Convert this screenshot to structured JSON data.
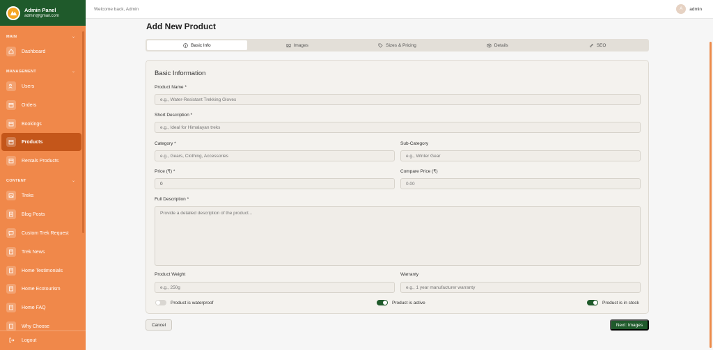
{
  "sidebar": {
    "title": "Admin Panel",
    "email": "admin@gmail.com",
    "sections": {
      "main": "MAIN",
      "management": "MANAGEMENT",
      "content": "CONTENT"
    },
    "items": [
      {
        "label": "Dashboard",
        "icon": "home-icon"
      },
      {
        "label": "Users",
        "icon": "users-icon"
      },
      {
        "label": "Orders",
        "icon": "calendar-icon"
      },
      {
        "label": "Bookings",
        "icon": "calendar-icon"
      },
      {
        "label": "Products",
        "icon": "calendar-icon",
        "active": true
      },
      {
        "label": "Rentals Products",
        "icon": "calendar-icon"
      },
      {
        "label": "Treks",
        "icon": "image-icon"
      },
      {
        "label": "Blog Posts",
        "icon": "document-icon"
      },
      {
        "label": "Custom Trek Request",
        "icon": "chat-icon"
      },
      {
        "label": "Trek News",
        "icon": "document-icon"
      },
      {
        "label": "Home Testimonials",
        "icon": "document-icon"
      },
      {
        "label": "Home Ecotourism",
        "icon": "document-icon"
      },
      {
        "label": "Home FAQ",
        "icon": "document-icon"
      },
      {
        "label": "Why Choose",
        "icon": "document-icon"
      }
    ],
    "logout": "Logout"
  },
  "topbar": {
    "welcome": "Welcome back, Admin",
    "user": "admin",
    "avatar_initial": "A"
  },
  "page": {
    "title": "Add New Product"
  },
  "tabs": [
    {
      "label": "Basic Info",
      "icon": "info-icon",
      "active": true
    },
    {
      "label": "Images",
      "icon": "image-icon"
    },
    {
      "label": "Sizes & Pricing",
      "icon": "tag-icon"
    },
    {
      "label": "Details",
      "icon": "box-icon"
    },
    {
      "label": "SEO",
      "icon": "link-icon"
    }
  ],
  "form": {
    "title": "Basic Information",
    "product_name": {
      "label": "Product Name *",
      "placeholder": "e.g., Water-Resistant Trekking Gloves"
    },
    "short_description": {
      "label": "Short Description *",
      "placeholder": "e.g., Ideal for Himalayan treks"
    },
    "category": {
      "label": "Category *",
      "placeholder": "e.g., Gears, Clothing, Accessories"
    },
    "sub_category": {
      "label": "Sub-Category",
      "placeholder": "e.g., Winter Gear"
    },
    "price": {
      "label": "Price (₹) *",
      "value": "0"
    },
    "compare_price": {
      "label": "Compare Price (₹)",
      "placeholder": "0.00"
    },
    "full_description": {
      "label": "Full Description *",
      "placeholder": "Provide a detailed description of the product..."
    },
    "weight": {
      "label": "Product Weight",
      "placeholder": "e.g., 250g"
    },
    "warranty": {
      "label": "Warranty",
      "placeholder": "e.g., 1 year manufacturer warranty"
    },
    "toggles": [
      {
        "label": "Product is waterproof",
        "on": false
      },
      {
        "label": "Product is active",
        "on": true
      },
      {
        "label": "Product is in stock",
        "on": true
      }
    ]
  },
  "actions": {
    "cancel": "Cancel",
    "next": "Next: Images"
  },
  "colors": {
    "sidebar": "#f0884a",
    "sidebar_header": "#1f5a2b",
    "active_item": "#c4561a",
    "primary": "#1f5a2b"
  }
}
